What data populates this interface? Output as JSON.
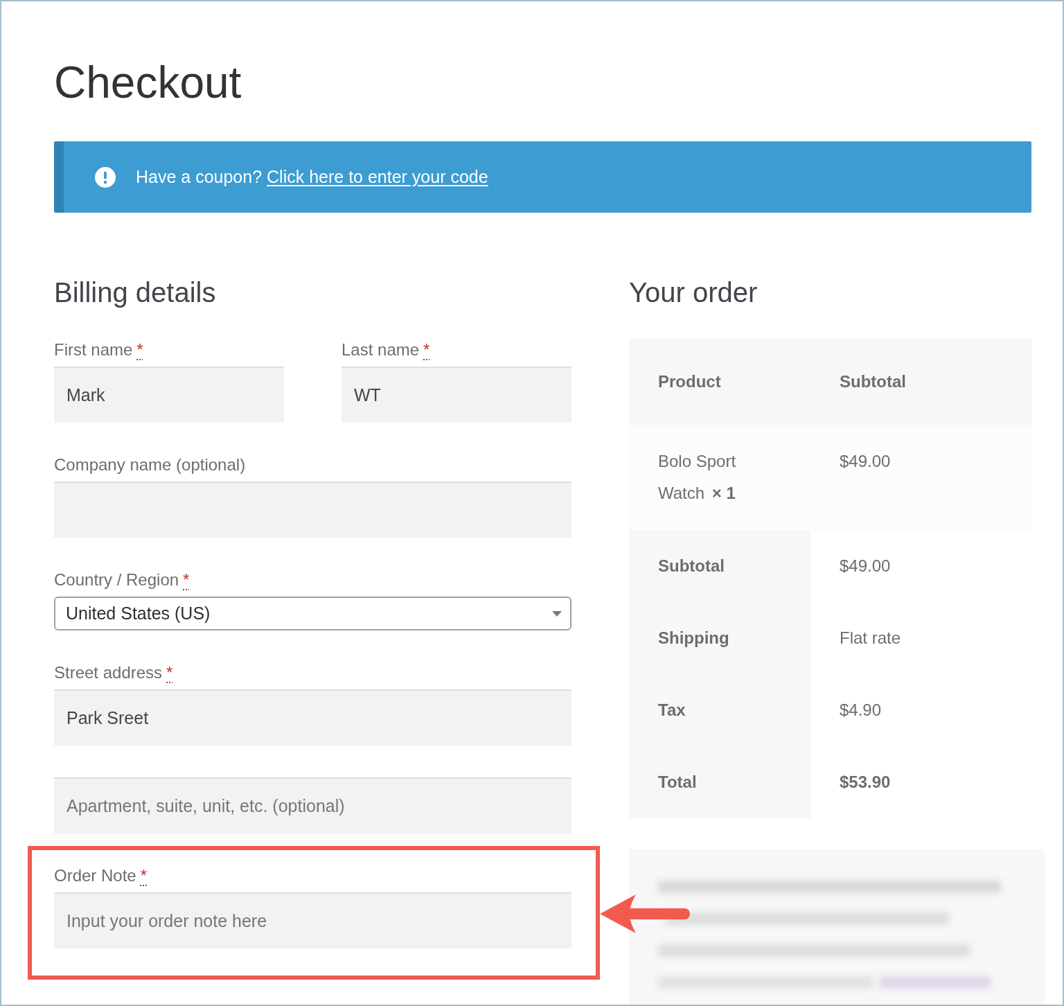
{
  "page": {
    "title": "Checkout"
  },
  "notice": {
    "message": "Have a coupon?",
    "link": "Click here to enter your code"
  },
  "billing": {
    "heading": "Billing details",
    "rows": [
      {
        "fields": [
          {
            "kind": "text",
            "label": "First name",
            "required_mark": "*",
            "value": "Mark",
            "highlighted": false
          },
          {
            "kind": "text",
            "label": "Last name",
            "required_mark": "*",
            "value": "WT",
            "highlighted": false
          }
        ]
      },
      {
        "fields": [
          {
            "kind": "text",
            "label": "Company name (optional)",
            "highlighted": false
          }
        ]
      },
      {
        "fields": [
          {
            "kind": "select",
            "label": "Country / Region",
            "required_mark": "*",
            "value": "United States (US)",
            "highlighted": false
          }
        ]
      },
      {
        "fields": [
          {
            "kind": "text",
            "label": "Street address",
            "required_mark": "*",
            "value": "Park Sreet",
            "highlighted": false
          }
        ]
      },
      {
        "fields": [
          {
            "kind": "text",
            "placeholder": "Apartment, suite, unit, etc. (optional)",
            "highlighted": false
          }
        ]
      },
      {
        "fields": [
          {
            "kind": "text",
            "label": "Order Note",
            "required_mark": "*",
            "placeholder": "Input your order note here",
            "highlighted": true
          }
        ]
      }
    ]
  },
  "order": {
    "heading": "Your order",
    "columns": [
      "Product",
      "Subtotal"
    ],
    "items": [
      {
        "name": "Bolo Sport Watch",
        "quantity": "× 1",
        "subtotal": "$49.00"
      }
    ],
    "totals": [
      {
        "label": "Subtotal",
        "value": "$49.00",
        "emphasis": false
      },
      {
        "label": "Shipping",
        "value": "Flat rate",
        "emphasis": false
      },
      {
        "label": "Tax",
        "value": "$4.90",
        "emphasis": false
      },
      {
        "label": "Total",
        "value": "$53.90",
        "emphasis": true
      }
    ]
  }
}
